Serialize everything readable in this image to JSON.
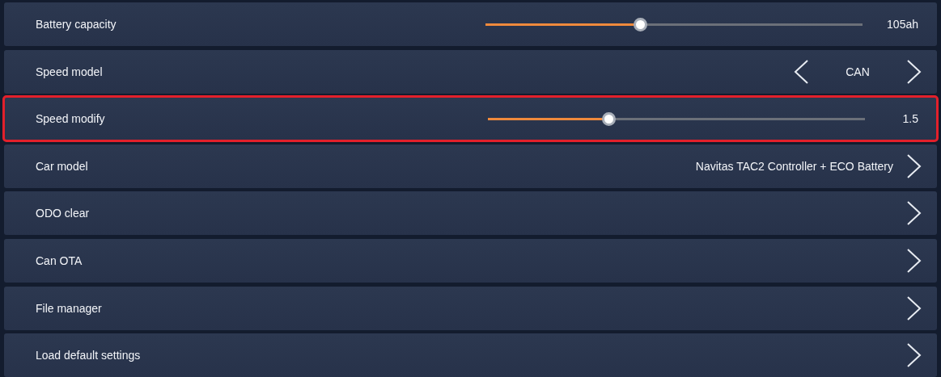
{
  "settings": [
    {
      "kind": "slider",
      "label": "Battery capacity",
      "level": 0.41,
      "value": "105ah",
      "highlighted": false
    },
    {
      "kind": "selector",
      "label": "Speed model",
      "value": "CAN",
      "highlighted": false
    },
    {
      "kind": "slider",
      "label": "Speed modify",
      "level": 0.32,
      "value": "1.5",
      "highlighted": true
    },
    {
      "kind": "link",
      "label": "Car model",
      "value": "Navitas TAC2 Controller + ECO Battery",
      "highlighted": false
    },
    {
      "kind": "link",
      "label": "ODO clear",
      "highlighted": false
    },
    {
      "kind": "link",
      "label": "Can OTA",
      "highlighted": false
    },
    {
      "kind": "link",
      "label": "File manager",
      "highlighted": false
    },
    {
      "kind": "link",
      "label": "Load default settings",
      "highlighted": false
    }
  ]
}
